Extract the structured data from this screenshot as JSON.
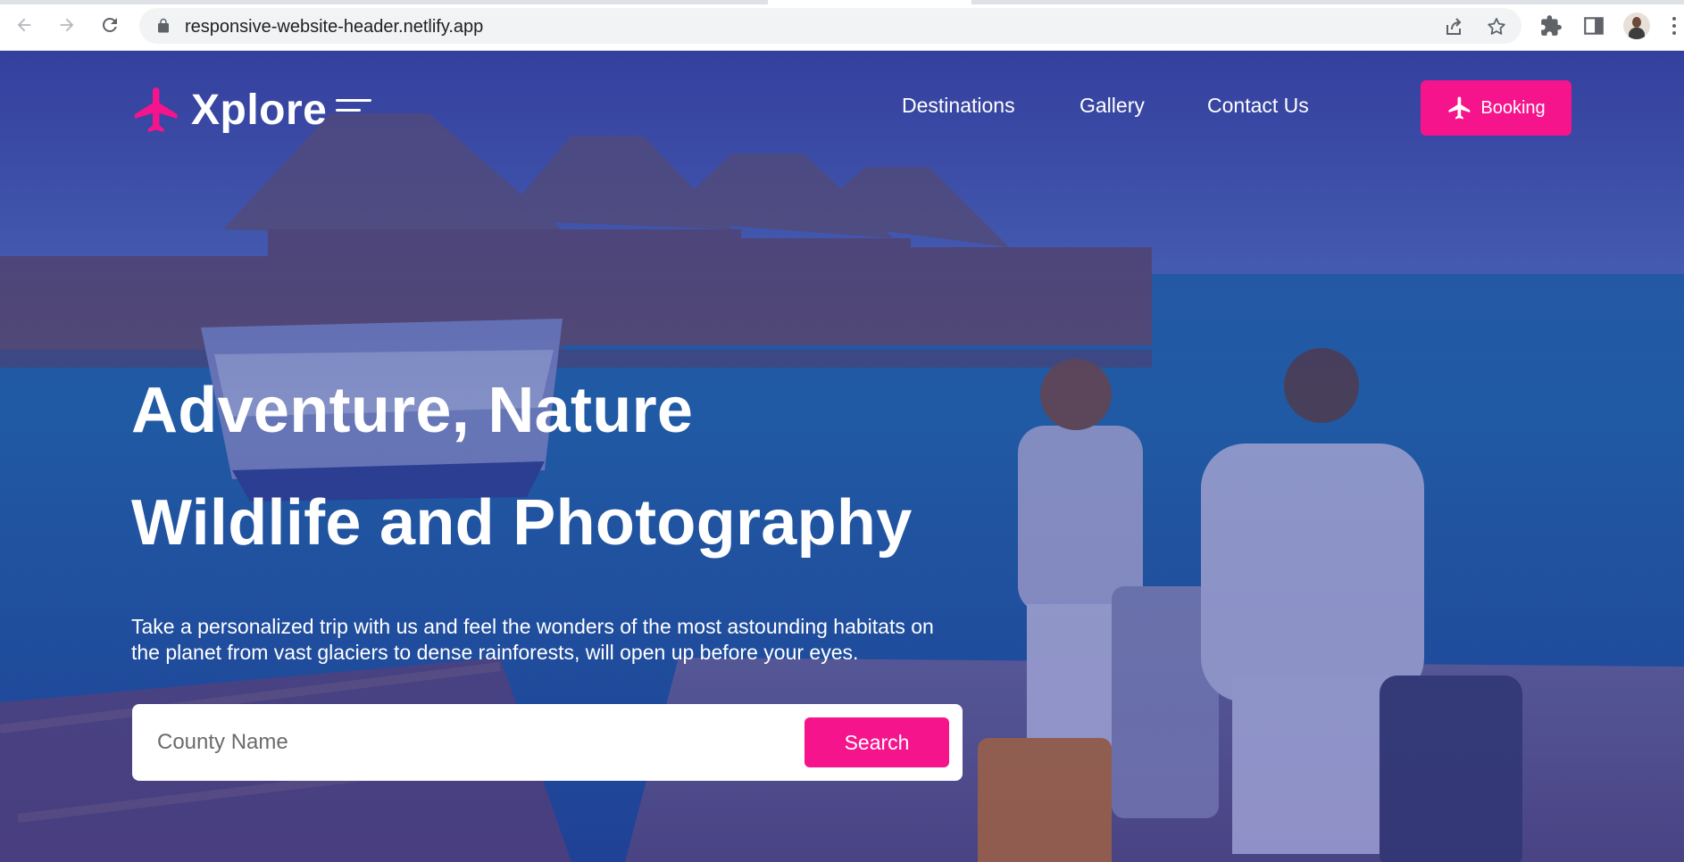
{
  "browser": {
    "url": "responsive-website-header.netlify.app",
    "icons": [
      "back-arrow-icon",
      "forward-arrow-icon",
      "reload-icon",
      "lock-icon",
      "share-icon",
      "star-icon",
      "extensions-icon",
      "side-panel-icon",
      "profile-avatar",
      "more-menu-icon"
    ]
  },
  "site": {
    "logo_text": "Xplore",
    "nav": [
      "Destinations",
      "Gallery",
      "Contact Us"
    ],
    "booking_label": "Booking",
    "hero": {
      "title_line1": "Adventure, Nature",
      "title_line2": "Wildlife and Photography",
      "description": "Take a personalized trip with us and feel the wonders of the most astounding habitats on the planet from vast glaciers to dense rainforests, will open up before your eyes."
    },
    "search": {
      "placeholder": "County Name",
      "button_label": "Search"
    }
  },
  "colors": {
    "accent": "#f5148b",
    "overlay": "#2f3597",
    "text": "#ffffff"
  }
}
